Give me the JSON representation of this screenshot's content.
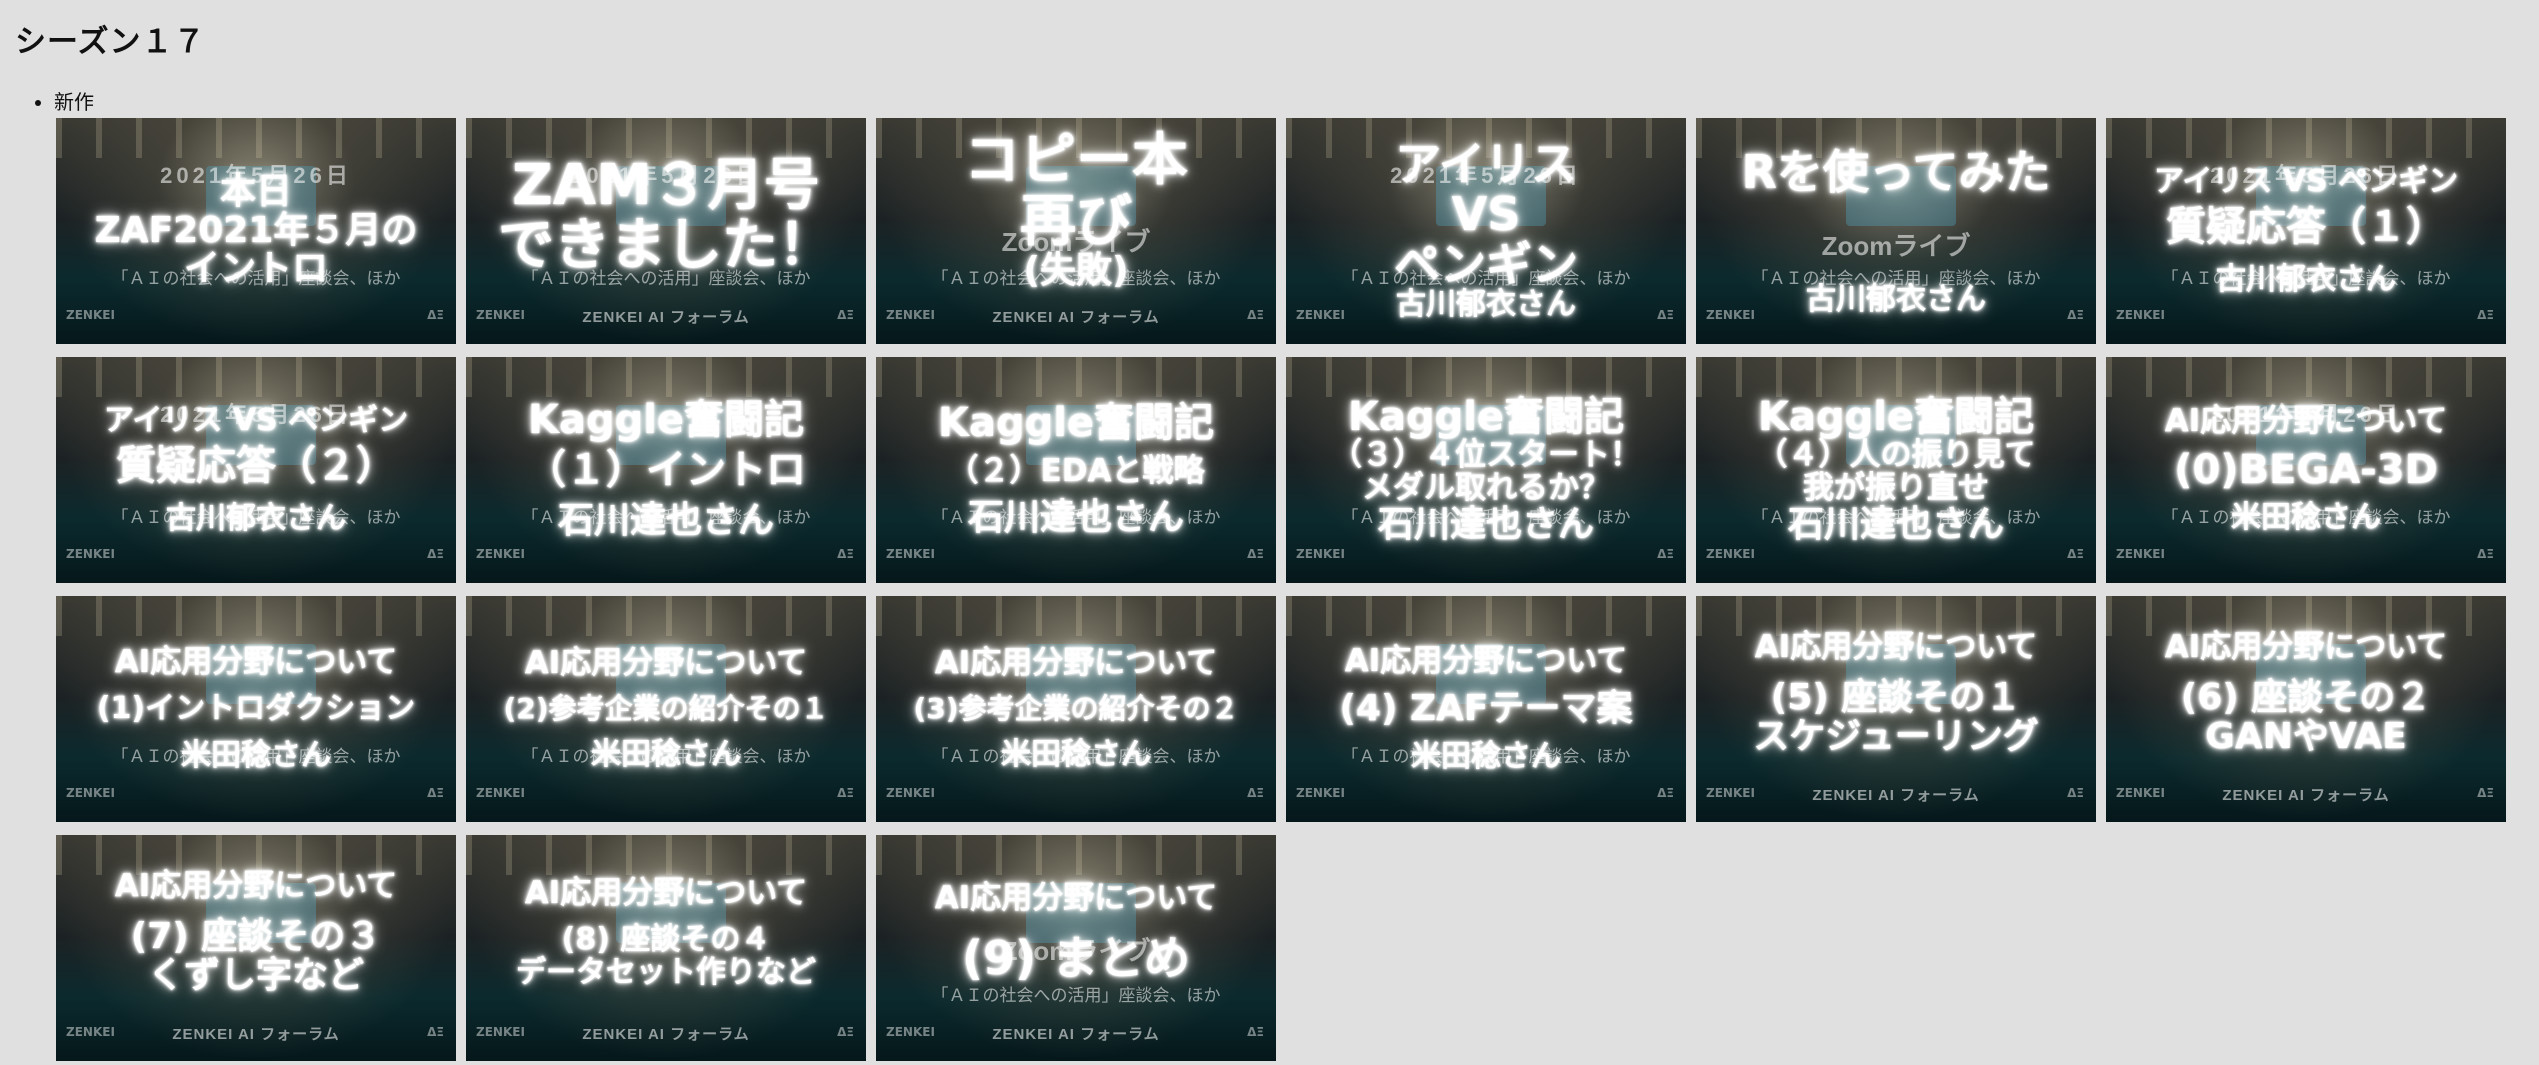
{
  "heading": "シーズン１７",
  "list_item": "新作",
  "background": {
    "date": "2021年5月26日",
    "zoom": "Zoomライブ",
    "topic": "「ＡＩの社会への活用」座談会、ほか",
    "brand": "ZENKEI AI フォーラム",
    "logo_left": "ZENKEI",
    "logo_right": "ΔΞ"
  },
  "thumbnails": [
    {
      "lines": [
        "本日",
        "ZAF2021年５月の",
        "イントロ"
      ]
    },
    {
      "lines": [
        "ZAM３月号",
        "できました！"
      ]
    },
    {
      "lines": [
        "コピー本",
        "再び",
        "(失敗)"
      ]
    },
    {
      "lines": [
        "アイリス",
        "VS",
        "ペンギン",
        "古川郁衣さん"
      ]
    },
    {
      "lines": [
        "Rを使ってみた",
        "古川郁衣さん"
      ]
    },
    {
      "lines": [
        "アイリス VS ペンギン",
        "質疑応答（１）",
        "古川郁衣さん"
      ]
    },
    {
      "lines": [
        "アイリス VS ペンギン",
        "質疑応答（２）",
        "古川郁衣さん"
      ]
    },
    {
      "lines": [
        "Kaggle奮闘記",
        "（１）イントロ",
        "石川達也さん"
      ]
    },
    {
      "lines": [
        "Kaggle奮闘記",
        "（２）EDAと戦略",
        "石川達也さん"
      ]
    },
    {
      "lines": [
        "Kaggle奮闘記",
        "（３）４位スタート！",
        "メダル取れるか？",
        "石川達也さん"
      ]
    },
    {
      "lines": [
        "Kaggle奮闘記",
        "（４）人の振り見て",
        "我が振り直せ",
        "石川達也さん"
      ]
    },
    {
      "lines": [
        "AI応用分野について",
        "(0)BEGA-3D",
        "米田稔さん"
      ]
    },
    {
      "lines": [
        "AI応用分野について",
        "(1)イントロダクション",
        "米田稔さん"
      ]
    },
    {
      "lines": [
        "AI応用分野について",
        "(2)参考企業の紹介その１",
        "米田稔さん"
      ]
    },
    {
      "lines": [
        "AI応用分野について",
        "(3)参考企業の紹介その２",
        "米田稔さん"
      ]
    },
    {
      "lines": [
        "AI応用分野について",
        "(4) ZAFテーマ案",
        "米田稔さん"
      ]
    },
    {
      "lines": [
        "AI応用分野について",
        "(5) 座談その１",
        "スケジューリング"
      ]
    },
    {
      "lines": [
        "AI応用分野について",
        "(6) 座談その２",
        "GANやVAE"
      ]
    },
    {
      "lines": [
        "AI応用分野について",
        "(7) 座談その３",
        "くずし字など"
      ]
    },
    {
      "lines": [
        "AI応用分野について",
        "(8) 座談その４",
        "データセット作りなど"
      ]
    },
    {
      "lines": [
        "AI応用分野について",
        "(9) まとめ"
      ]
    }
  ]
}
